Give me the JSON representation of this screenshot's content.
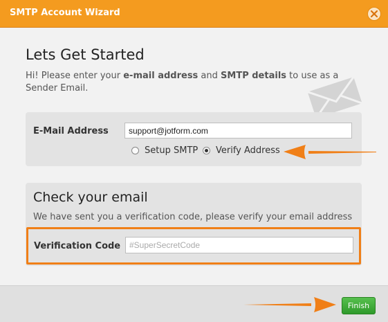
{
  "window": {
    "title": "SMTP Account Wizard",
    "accent": "#f49b1f"
  },
  "intro": {
    "heading": "Lets Get Started",
    "text_1": "Hi! Please enter your ",
    "bold_1": "e-mail address",
    "text_2": " and ",
    "bold_2": "SMTP details",
    "text_3": " to use as a Sender Email."
  },
  "email_section": {
    "label": "E-Mail Address",
    "value": "support@jotform.com",
    "options": [
      {
        "label": "Setup SMTP",
        "selected": false
      },
      {
        "label": "Verify Address",
        "selected": true
      }
    ]
  },
  "verify_section": {
    "title": "Check your email",
    "description": "We have sent you a verification code, please verify your email address",
    "code_label": "Verification Code",
    "code_value": "",
    "code_placeholder": "#SuperSecretCode",
    "highlight_color": "#f07f17"
  },
  "footer": {
    "finish_label": "Finish",
    "finish_color": "#3aa935"
  },
  "icons": {
    "close": "close-icon",
    "envelope": "envelope-icon",
    "arrow": "arrow-icon"
  }
}
